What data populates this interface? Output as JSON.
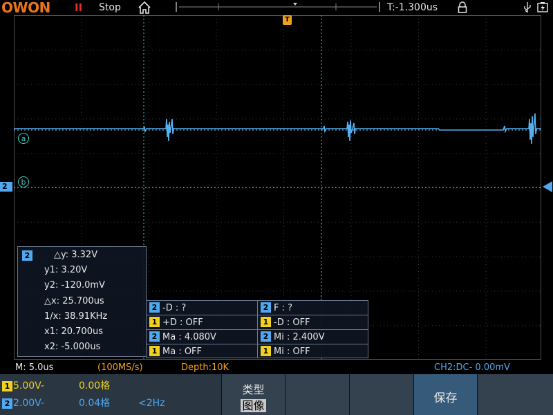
{
  "topbar": {
    "logo": "OWON",
    "run_indicator": "II",
    "state": "Stop",
    "trigger_time": "T:-1.300us"
  },
  "markers": {
    "trigger": "T",
    "cursor_a": "a",
    "cursor_b": "b",
    "channel2": "2"
  },
  "cursor_panel": {
    "channel": "2",
    "dy": "△y: 3.32V",
    "y1": "y1: 3.20V",
    "y2": "y2: -120.0mV",
    "dx": "△x: 25.700us",
    "inv_x": "1/x: 38.91KHz",
    "x1": "x1: 20.700us",
    "x2": "x2: -5.000us"
  },
  "measure_panel": {
    "rows": [
      {
        "left_ch": "2",
        "left": "-D :    ?",
        "right_ch": "2",
        "right": "F :     ?"
      },
      {
        "left_ch": "1",
        "left": "+D : OFF",
        "right_ch": "1",
        "right": "-D : OFF"
      },
      {
        "left_ch": "2",
        "left": "Ma : 4.080V",
        "right_ch": "2",
        "right": "Mi : 2.400V"
      },
      {
        "left_ch": "1",
        "left": "Ma : OFF",
        "right_ch": "1",
        "right": "Mi : OFF"
      }
    ]
  },
  "info": {
    "timebase": "M: 5.0us",
    "sample_rate": "(100MS/s)",
    "depth": "Depth:10K",
    "trigger_info": "CH2:DC-  0.00mV"
  },
  "bottom": {
    "ch1_badge": "1",
    "ch1_scale": "5.00V-",
    "ch1_offset": "0.00格",
    "ch2_badge": "2",
    "ch2_scale": "2.00V-",
    "ch2_offset": "0.04格",
    "ch2_freq": "<2Hz",
    "softkey_type_label": "类型",
    "softkey_type_value": "图像",
    "softkey_save": "保存"
  },
  "colors": {
    "ch1": "#f0d020",
    "ch2": "#4fa8f0",
    "cursor": "#39d2c8",
    "trigger": "#f0a020",
    "logo": "#e8751a"
  }
}
